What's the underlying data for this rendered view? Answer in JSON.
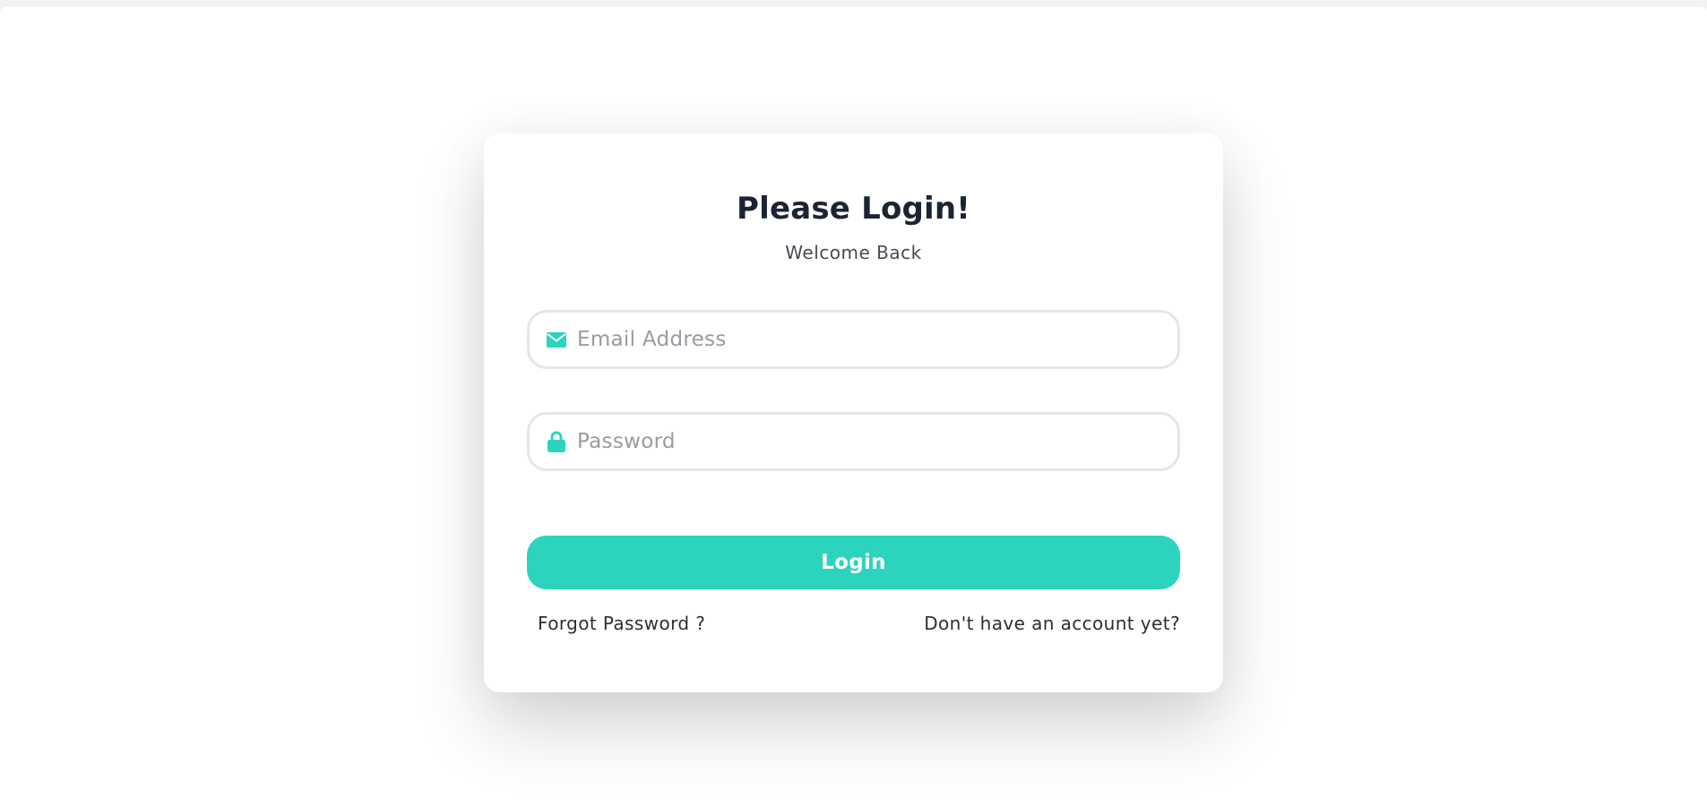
{
  "login": {
    "title": "Please Login!",
    "subtitle": "Welcome Back",
    "email": {
      "placeholder": "Email Address",
      "value": "",
      "icon": "envelope-icon"
    },
    "password": {
      "placeholder": "Password",
      "value": "",
      "icon": "lock-icon"
    },
    "submit_label": "Login",
    "forgot_link": "Forgot Password ?",
    "signup_link": "Don't have an account yet?"
  },
  "colors": {
    "accent": "#2cd4bd",
    "title": "#1c2433",
    "placeholder": "#9a9aa2",
    "input_border": "#e6e6e6"
  }
}
